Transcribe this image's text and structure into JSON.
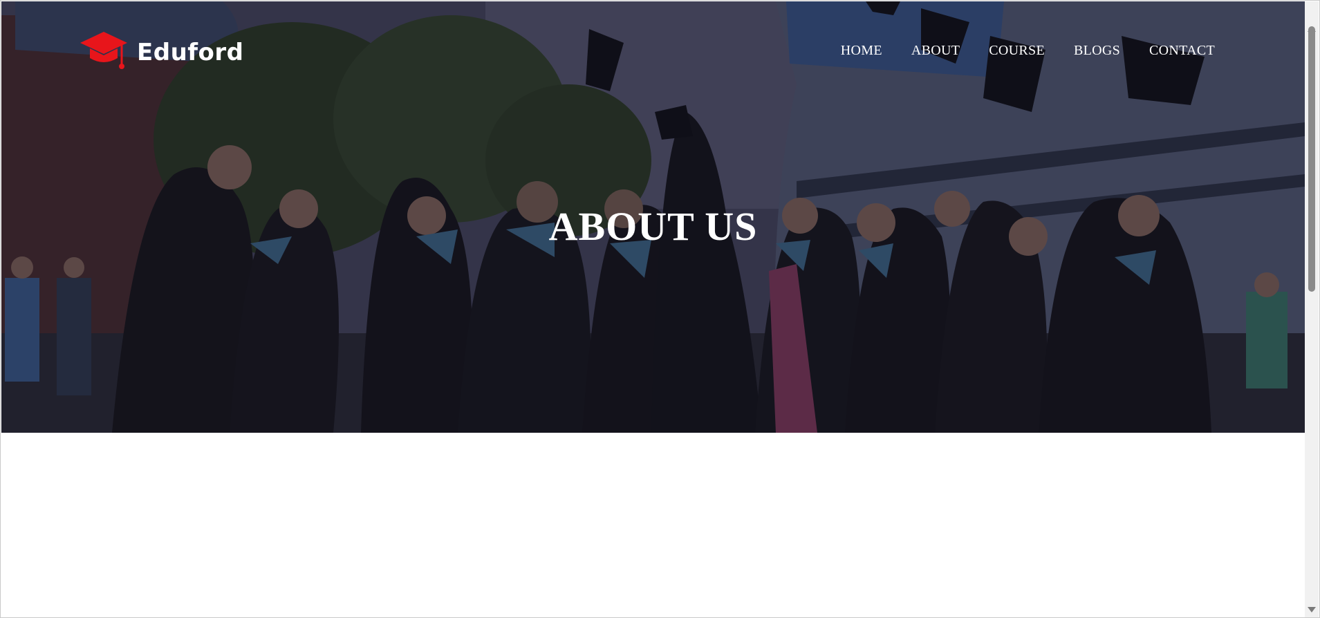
{
  "brand": {
    "name": "Eduford",
    "logo_icon": "graduation-cap-icon",
    "logo_color": "#e8151b"
  },
  "nav": {
    "items": [
      {
        "label": "HOME"
      },
      {
        "label": "ABOUT"
      },
      {
        "label": "COURSE"
      },
      {
        "label": "BLOGS"
      },
      {
        "label": "CONTACT"
      }
    ]
  },
  "hero": {
    "title": "ABOUT US",
    "image": "graduates-throwing-caps-photo"
  },
  "scrollbar": {
    "up_icon": "scroll-up-arrow-icon",
    "down_icon": "scroll-down-arrow-icon"
  }
}
